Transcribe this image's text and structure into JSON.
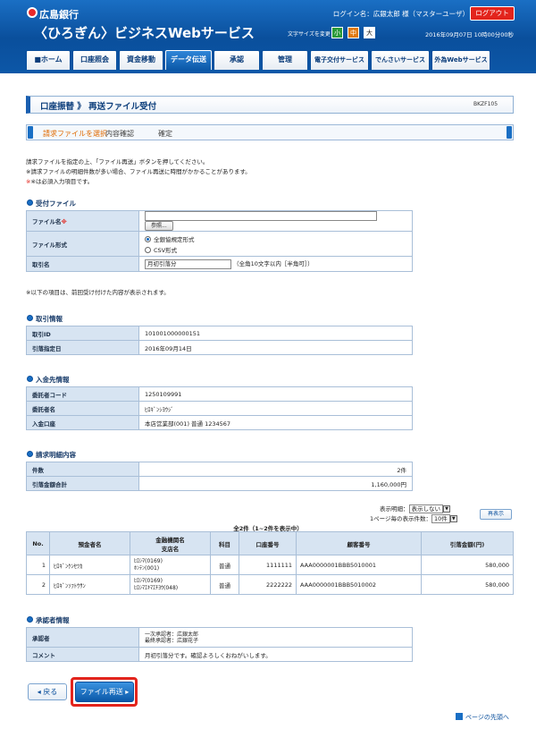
{
  "header": {
    "bank_name": "広島銀行",
    "service_name": "〈ひろぎん〉ビジネスWebサービス",
    "login_label": "ログイン名：広銀太郎 様（マスターユーザ）",
    "logout": "ログアウト",
    "font_size_label": "文字サイズを変更",
    "font_small": "小",
    "font_medium": "中",
    "font_large": "大",
    "datetime": "2016年09月07日 10時00分00秒"
  },
  "nav": {
    "tabs": [
      "ホーム",
      "口座照会",
      "資金移動",
      "データ伝送",
      "承認",
      "管理",
      "電子交付サービス",
      "でんさいサービス",
      "外為Webサービス"
    ],
    "active": "データ伝送"
  },
  "page": {
    "title": "口座振替 》 再送ファイル受付",
    "screen_id": "BKZF105",
    "steps": [
      "請求ファイルを選択",
      "内容確認",
      "確定"
    ],
    "instructions": [
      "請求ファイルを指定の上、「ファイル再送」ボタンを押してください。",
      "※請求ファイルの明細件数が多い場合、ファイル再送に時間がかかることがあります。",
      "※は必須入力項目です。"
    ],
    "note": "※以下の項目は、前回受け付けた内容が表示されます。"
  },
  "upload": {
    "section": "受付ファイル",
    "file_name_label": "ファイル名",
    "file_name_req": "※",
    "browse": "参照...",
    "format_label": "ファイル形式",
    "format_options": [
      "全銀協規定形式",
      "CSV形式"
    ],
    "torimei_label": "取引名",
    "torimei_value": "月初引落分",
    "torimei_hint": "（全角10文字以内［半角可］）"
  },
  "torihiki": {
    "section": "取引情報",
    "rows": [
      [
        "取引ID",
        "101001000000151"
      ],
      [
        "引落指定日",
        "2016年09月14日"
      ]
    ]
  },
  "nyukin": {
    "section": "入金先情報",
    "rows": [
      [
        "委託者コード",
        "1250109991"
      ],
      [
        "委託者名",
        "ﾋﾛｷﾞﾝｼﾖｳｼﾞ"
      ],
      [
        "入金口座",
        "本店営業部(001) 普通 1234567"
      ]
    ]
  },
  "meisai": {
    "section": "請求明細内容",
    "rows": [
      [
        "件数",
        "2件"
      ],
      [
        "引落金額合計",
        "1,160,000円"
      ]
    ]
  },
  "list": {
    "display_label": "表示明細：",
    "display_value": "表示しない",
    "per_page_label": "1ページ毎の表示件数：",
    "per_page_value": "10件",
    "display_button": "再表示",
    "count": "全2件（1~2件を表示中）",
    "headers": [
      "No.",
      "預金者名",
      "金融機関名",
      "支店名",
      "科目",
      "口座番号",
      "顧客番号",
      "引落金額(円)"
    ],
    "rows": [
      {
        "no": "1",
        "name": "ﾋﾛｷﾞﾝｹﾝｾﾂｶ",
        "bank": "ﾋﾛｼﾏ(0169)",
        "branch": "ﾎﾝﾃﾝ(001)",
        "kamoku": "普通",
        "acct": "1111111",
        "cust": "AAA0000001BBB5010001",
        "amount": "580,000"
      },
      {
        "no": "2",
        "name": "ﾋﾛｷﾞﾝｿﾌﾄｳｻﾝ",
        "bank": "ﾋﾛｼﾏ(0169)",
        "branch": "ﾋﾛｼﾏｴｷﾏｴﾁﾖｳ(048)",
        "kamoku": "普通",
        "acct": "2222222",
        "cust": "AAA0000001BBB5010002",
        "amount": "580,000"
      }
    ]
  },
  "approver": {
    "section": "承認者情報",
    "approver_label": "承認者",
    "approver_lines": [
      "一次承認者：広銀太郎",
      "最終承認者：広銀花子"
    ],
    "comment_label": "コメント",
    "comment": "月初引落分です。確認よろしくおねがいします。"
  },
  "buttons": {
    "back": "戻る",
    "resend": "ファイル再送"
  },
  "footer": {
    "to_top": "ページの先頭へ"
  }
}
